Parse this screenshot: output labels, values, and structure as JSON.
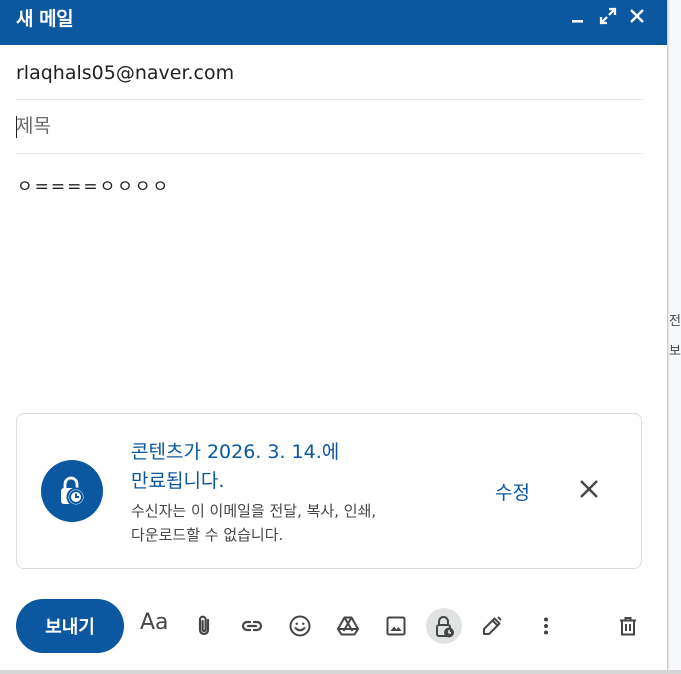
{
  "background": {
    "side_text": [
      "전",
      "보"
    ]
  },
  "compose": {
    "title": "새 메일",
    "header_icons": [
      "minimize-icon",
      "fullscreen-icon",
      "close-icon"
    ],
    "to_value": "rlaqhals05@naver.com",
    "subject_placeholder": "제목",
    "body_text": "ㅇ====ㅇㅇㅇㅇ"
  },
  "confidential": {
    "icon": "timer-lock-icon",
    "title": "콘텐츠가 2026. 3. 14.에 만료됩니다.",
    "subtitle": "수신자는 이 이메일을 전달, 복사, 인쇄, 다운로드할 수 없습니다.",
    "edit_label": "수정",
    "close_icon": "close-icon"
  },
  "toolbar": {
    "send_label": "보내기",
    "format_label": "Aa",
    "icons": [
      "attach-icon",
      "link-icon",
      "emoji-icon",
      "drive-icon",
      "photo-icon",
      "confidential-lock-icon",
      "signature-pen-icon",
      "more-vert-icon",
      "trash-icon"
    ]
  },
  "colors": {
    "brand": "#0b57a0",
    "text": "#202124",
    "muted": "#444746",
    "border": "#dadce0"
  }
}
